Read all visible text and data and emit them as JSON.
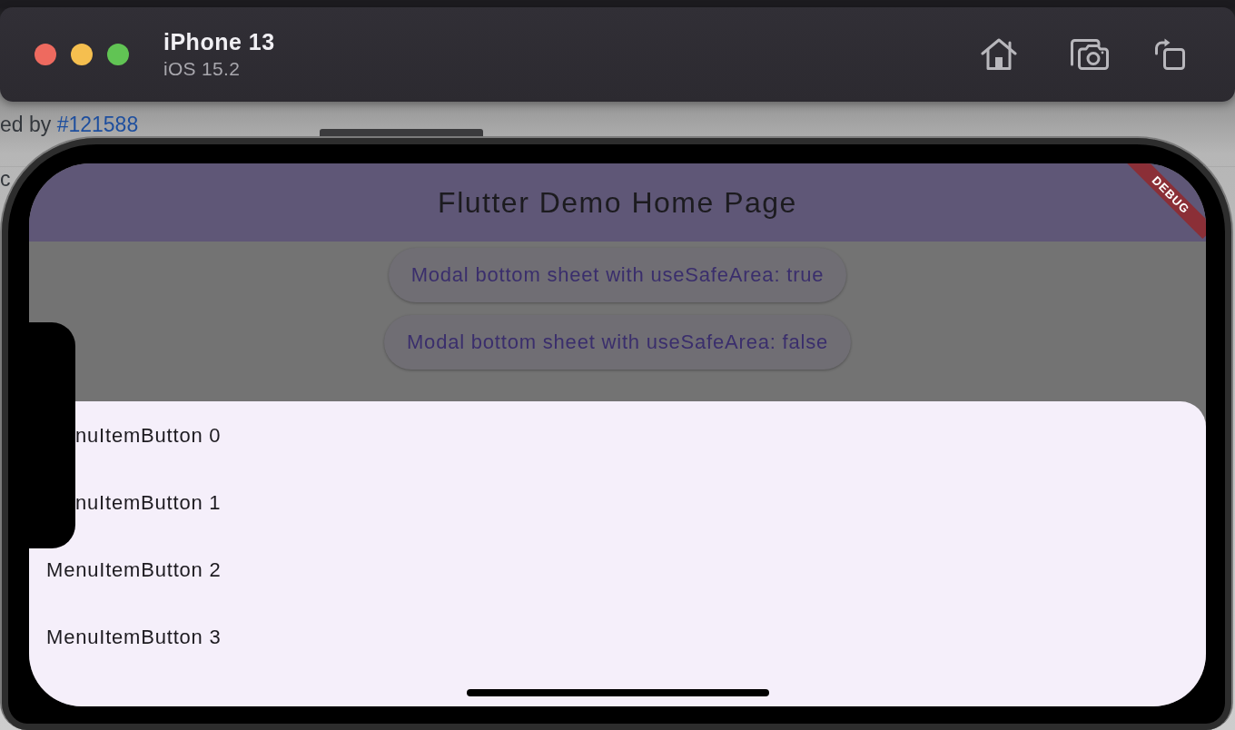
{
  "simulator": {
    "title": "iPhone 13",
    "subtitle": "iOS 15.2"
  },
  "background_page": {
    "lines": [
      {
        "text": "ed by",
        "link": "#121588"
      },
      {
        "text": "c"
      }
    ]
  },
  "app": {
    "app_bar": {
      "title": "Flutter Demo Home Page"
    },
    "debug_banner": {
      "label": "DEBUG"
    },
    "buttons": [
      {
        "label": "Modal bottom sheet with useSafeArea: true"
      },
      {
        "label": "Modal bottom sheet with useSafeArea: false"
      }
    ],
    "bottom_sheet": {
      "items": [
        {
          "label": "nuItemButton 0"
        },
        {
          "label": "nuItemButton 1"
        },
        {
          "label": "MenuItemButton 2"
        },
        {
          "label": "MenuItemButton 3"
        }
      ]
    }
  }
}
